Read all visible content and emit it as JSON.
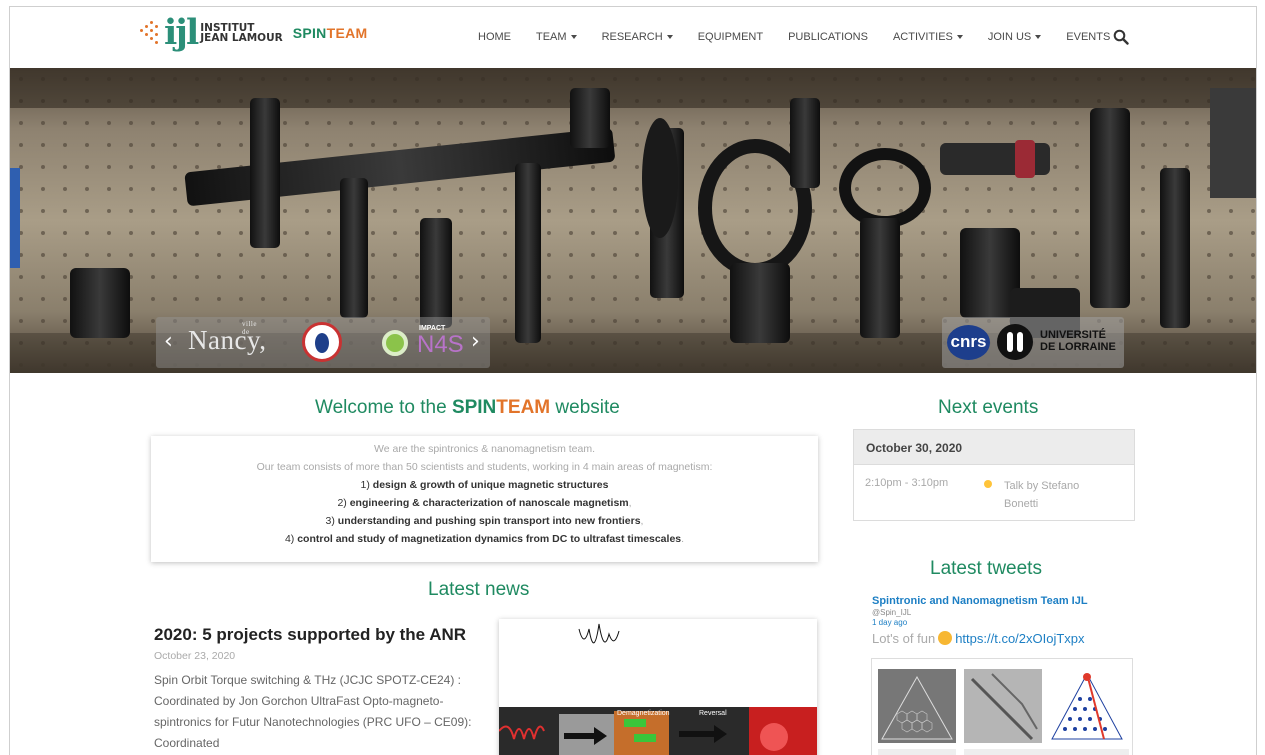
{
  "brand": {
    "logo_mark": "ijl",
    "institute_line1": "INSTITUT",
    "institute_line2": "JEAN LAMOUR",
    "team_part1": "SPIN",
    "team_part2": "TEAM"
  },
  "nav": {
    "items": [
      {
        "label": "HOME",
        "dropdown": false
      },
      {
        "label": "TEAM",
        "dropdown": true
      },
      {
        "label": "RESEARCH",
        "dropdown": true
      },
      {
        "label": "EQUIPMENT",
        "dropdown": false
      },
      {
        "label": "PUBLICATIONS",
        "dropdown": false
      },
      {
        "label": "ACTIVITIES",
        "dropdown": true
      },
      {
        "label": "JOIN US",
        "dropdown": true
      },
      {
        "label": "EVENTS",
        "dropdown": false
      }
    ],
    "search_icon": "search-icon"
  },
  "hero": {
    "prev_arrow": "‹",
    "next_arrow": "›",
    "partner_logos_left": {
      "nancy": "Nancy,",
      "nancy_small": "ville de",
      "impact": "IMPACT",
      "n4s": "N4S"
    },
    "partner_logos_right": {
      "cnrs": "cnrs",
      "univ_line1": "UNIVERSITÉ",
      "univ_line2": "DE LORRAINE"
    }
  },
  "welcome": {
    "title_prefix": "Welcome to the ",
    "title_spin": "SPIN",
    "title_team": "TEAM",
    "title_suffix": " website",
    "intro1": "We are the spintronics & nanomagnetism team.",
    "intro2": "Our team consists of more than 50 scientists and students, working in 4 main areas of magnetism:",
    "areas": [
      {
        "num": "1) ",
        "text": "design & growth of unique magnetic structures",
        "end": ""
      },
      {
        "num": "2) ",
        "text": "engineering & characterization of nanoscale magnetism",
        "end": ","
      },
      {
        "num": "3) ",
        "text": "understanding and pushing spin transport into new frontiers",
        "end": ","
      },
      {
        "num": "4) ",
        "text": "control and study of magnetization dynamics from DC to ultrafast timescales",
        "end": "."
      }
    ]
  },
  "events": {
    "title": "Next events",
    "date": "October 30, 2020",
    "time": "2:10pm - 3:10pm",
    "event_title": "Talk by Stefano Bonetti",
    "dot_color": "#ffc43a"
  },
  "news": {
    "title": "Latest news",
    "article_title": "2020: 5 projects supported by the ANR",
    "article_date": "October 23, 2020",
    "article_body": "Spin Orbit Torque switching & THz (JCJC SPOTZ-CE24) : Coordinated  by Jon Gorchon UltraFast Opto-magneto-spintronics for Futur Nanotechnologies (PRC UFO – CE09): Coordinated",
    "image_label_left": "Demagnetization",
    "image_label_right": "Reversal"
  },
  "tweets": {
    "title": "Latest tweets",
    "name": "Spintronic and Nanomagnetism Team IJL",
    "handle": "@Spin_IJL",
    "time": "1 day ago",
    "text": "Lot's of fun",
    "link": "https://t.co/2xOIojTxpx"
  },
  "colors": {
    "brand_green": "#1f8a61",
    "brand_orange": "#e2742a",
    "twitter_blue": "#1d7fc4"
  }
}
